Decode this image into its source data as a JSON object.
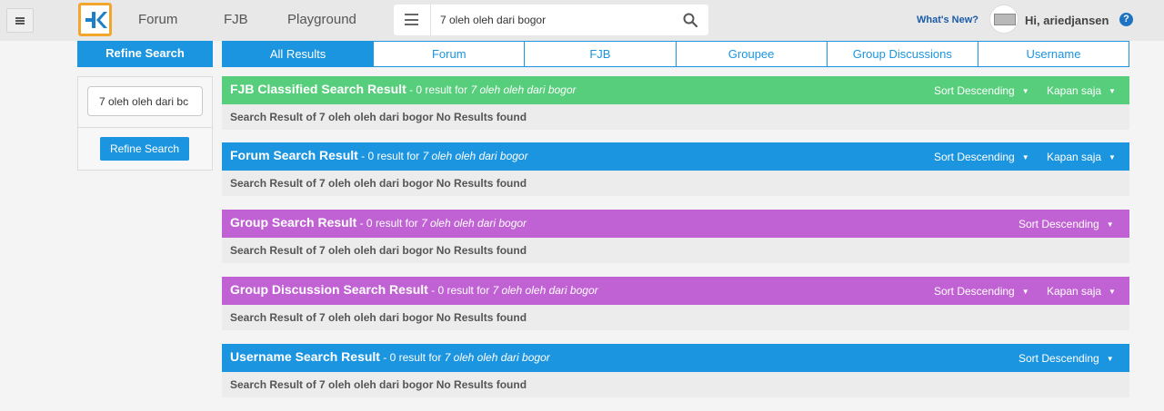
{
  "header": {
    "nav": [
      "Forum",
      "FJB",
      "Playground"
    ],
    "search_value": "7 oleh oleh dari bogor",
    "whats_new": "What's New?",
    "greeting": "Hi, ariedjansen",
    "help": "?"
  },
  "sidebar": {
    "header": "Refine Search",
    "input_value": "7 oleh oleh dari bc",
    "button": "Refine Search"
  },
  "tabs": [
    "All Results",
    "Forum",
    "FJB",
    "Groupee",
    "Group Discussions",
    "Username"
  ],
  "sections": [
    {
      "title": "FJB Classified Search Result",
      "meta": " - 0 result for ",
      "query": "7 oleh oleh dari bogor",
      "sort": "Sort Descending",
      "time": "Kapan saja",
      "body": "Search Result of 7 oleh oleh dari bogor No Results found"
    },
    {
      "title": "Forum Search Result",
      "meta": " - 0 result for ",
      "query": "7 oleh oleh dari bogor",
      "sort": "Sort Descending",
      "time": "Kapan saja",
      "body": "Search Result of 7 oleh oleh dari bogor No Results found"
    },
    {
      "title": "Group Search Result",
      "meta": " - 0 result for ",
      "query": "7 oleh oleh dari bogor",
      "sort": "Sort Descending",
      "body": "Search Result of 7 oleh oleh dari bogor No Results found"
    },
    {
      "title": "Group Discussion Search Result",
      "meta": " - 0 result for ",
      "query": "7 oleh oleh dari bogor",
      "sort": "Sort Descending",
      "time": "Kapan saja",
      "body": "Search Result of 7 oleh oleh dari bogor No Results found"
    },
    {
      "title": "Username Search Result",
      "meta": " - 0 result for ",
      "query": "7 oleh oleh dari bogor",
      "sort": "Sort Descending",
      "body": "Search Result of 7 oleh oleh dari bogor No Results found"
    }
  ],
  "colors": {
    "fjb": "#56ce7b",
    "forum": "#1b95e0",
    "group": "#c162d4",
    "accent": "#1b95e0",
    "logo_border": "#f2a62b"
  },
  "icons": [
    "hamburger-icon",
    "kaskus-logo-icon",
    "search-menu-icon",
    "search-icon",
    "help-icon",
    "caret-down-icon"
  ]
}
